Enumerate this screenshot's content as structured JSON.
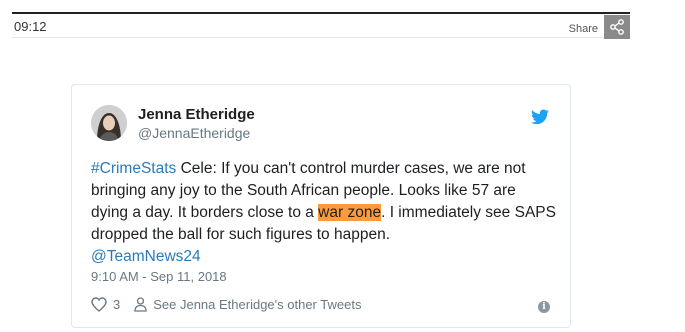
{
  "topbar": {
    "time": "09:12",
    "share_label": "Share",
    "share_icon": "share-icon"
  },
  "tweet": {
    "name": "Jenna Etheridge",
    "handle": "@JennaEtheridge",
    "brand_icon": "twitter-bird-icon",
    "hashtag": "#CrimeStats",
    "text_part1": " Cele: If you can't control murder cases, we are not bringing any joy to the South African people. Looks like 57 are dying a day. It borders close to a ",
    "highlight": "war zone",
    "text_part2": ". I immediately see SAPS dropped the ball for such figures to happen.",
    "mention": "@TeamNews24",
    "timestamp": "9:10 AM - Sep 11, 2018",
    "likes": "3",
    "profile_link": "See Jenna Etheridge's other Tweets",
    "info_icon": "info-icon"
  },
  "colors": {
    "link": "#2b7bb9",
    "highlight": "#ff9a3c",
    "brand": "#1da1f2"
  }
}
